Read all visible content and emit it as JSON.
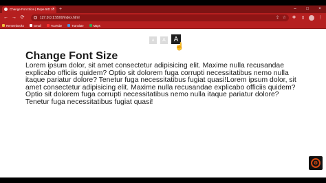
{
  "browser": {
    "tab": {
      "title": "Change Font Size | Rope 5ID 10",
      "close": "×"
    },
    "new_tab": "+",
    "window_controls": [
      "–",
      "□",
      "×"
    ],
    "nav": {
      "back": "←",
      "forward": "→",
      "reload": "⟳"
    },
    "address_bar": {
      "url_prefix": "",
      "url_host": "127.0.0.1",
      "url_rest": ":5500/index.html"
    },
    "bookmarks": [
      {
        "label": "Remembooks",
        "icon": "bookmark-icon",
        "color": "#f0c040"
      },
      {
        "label": "Gmail",
        "icon": "gmail-icon",
        "color": "#ffffff"
      },
      {
        "label": "YouTube",
        "icon": "youtube-icon",
        "color": "#ff3030"
      },
      {
        "label": "Translate",
        "icon": "translate-icon",
        "color": "#4a90e2"
      },
      {
        "label": "Maps",
        "icon": "maps-icon",
        "color": "#34a853"
      }
    ]
  },
  "page": {
    "size_buttons": [
      "A",
      "A",
      "A"
    ],
    "heading": "Change Font Size",
    "paragraph": "Lorem ipsum dolor, sit amet consectetur adipisicing elit. Maxime nulla recusandae explicabo officiis quidem? Optio sit dolorem fuga corrupti necessitatibus nemo nulla itaque pariatur dolore? Tenetur fuga necessitatibus fugiat quasi!Lorem ipsum dolor, sit amet consectetur adipisicing elit. Maxime nulla recusandae explicabo officiis quidem? Optio sit dolorem fuga corrupti necessitatibus nemo nulla itaque pariatur dolore? Tenetur fuga necessitatibus fugiat quasi!"
  },
  "colors": {
    "browser_chrome": "#b51f1f",
    "tab_strip": "#7d1414",
    "active_size_button": "#1f1f1f",
    "inactive_size_button": "#dcdcdc",
    "badge_accent": "#d94a12"
  }
}
